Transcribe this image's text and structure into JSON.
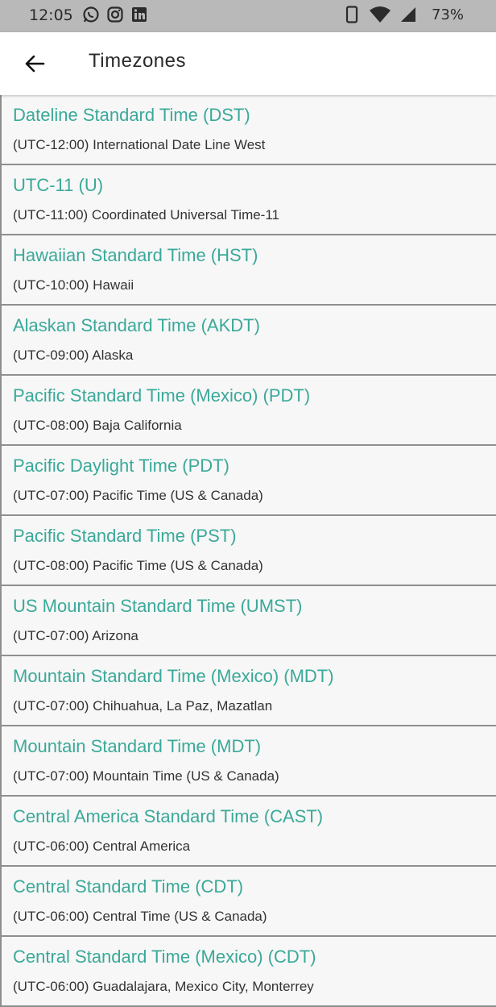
{
  "status_bar": {
    "time": "12:05",
    "battery": "73%",
    "left_icons": [
      "whatsapp-icon",
      "instagram-icon",
      "linkedin-icon"
    ],
    "right_icons": [
      "phone-icon",
      "wifi-icon",
      "signal-icon"
    ]
  },
  "header": {
    "title": "Timezones",
    "back_icon": "arrow-left-icon"
  },
  "colors": {
    "accent": "#3aa999",
    "status_bar_bg": "#b9b9b9",
    "divider": "#8f8f8f"
  },
  "timezones": [
    {
      "name": "Dateline Standard Time (DST)",
      "detail": "(UTC-12:00) International Date Line West"
    },
    {
      "name": "UTC-11 (U)",
      "detail": "(UTC-11:00) Coordinated Universal Time-11"
    },
    {
      "name": "Hawaiian Standard Time (HST)",
      "detail": "(UTC-10:00) Hawaii"
    },
    {
      "name": "Alaskan Standard Time (AKDT)",
      "detail": "(UTC-09:00) Alaska"
    },
    {
      "name": "Pacific Standard Time (Mexico) (PDT)",
      "detail": "(UTC-08:00) Baja California"
    },
    {
      "name": "Pacific Daylight Time (PDT)",
      "detail": "(UTC-07:00) Pacific Time (US & Canada)"
    },
    {
      "name": "Pacific Standard Time (PST)",
      "detail": "(UTC-08:00) Pacific Time (US & Canada)"
    },
    {
      "name": "US Mountain Standard Time (UMST)",
      "detail": "(UTC-07:00) Arizona"
    },
    {
      "name": "Mountain Standard Time (Mexico) (MDT)",
      "detail": "(UTC-07:00) Chihuahua, La Paz, Mazatlan"
    },
    {
      "name": "Mountain Standard Time (MDT)",
      "detail": "(UTC-07:00) Mountain Time (US & Canada)"
    },
    {
      "name": "Central America Standard Time (CAST)",
      "detail": "(UTC-06:00) Central America"
    },
    {
      "name": "Central Standard Time (CDT)",
      "detail": "(UTC-06:00) Central Time (US & Canada)"
    },
    {
      "name": "Central Standard Time (Mexico) (CDT)",
      "detail": "(UTC-06:00) Guadalajara, Mexico City, Monterrey"
    }
  ]
}
